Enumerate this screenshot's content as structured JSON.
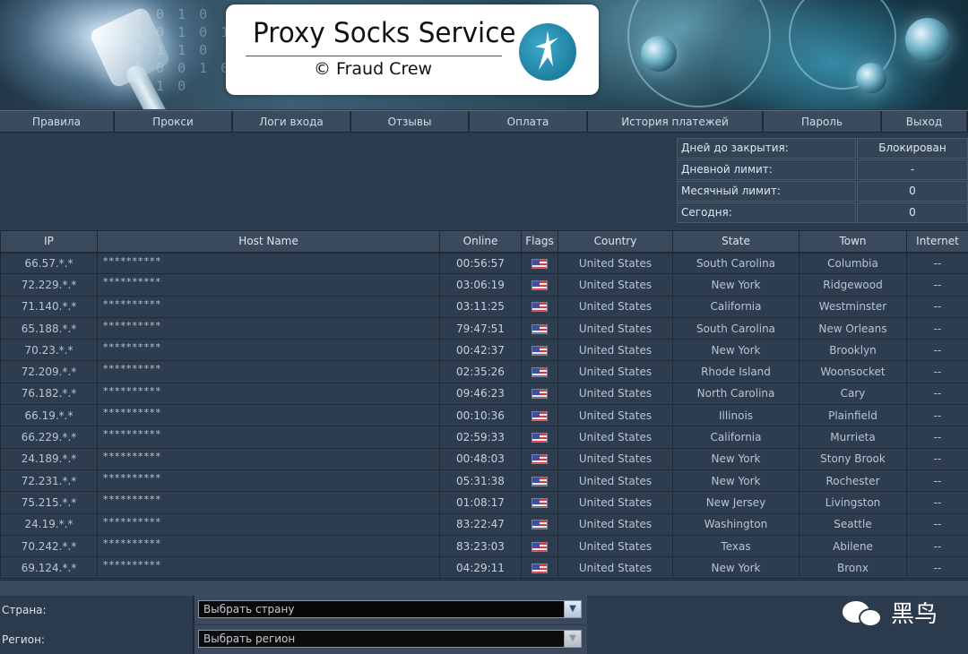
{
  "header": {
    "title": "Proxy Socks Service",
    "subtitle": "© Fraud Crew",
    "binary_text": "0 0 1 0\n1 0 1 0 1\n0 1 1 0\n1 0 0 1 0\n0 1 0"
  },
  "nav": [
    {
      "label": "Правила",
      "w": 128
    },
    {
      "label": "Прокси",
      "w": 132
    },
    {
      "label": "Логи входа",
      "w": 132
    },
    {
      "label": "Отзывы",
      "w": 132
    },
    {
      "label": "Оплата",
      "w": 132
    },
    {
      "label": "История платежей",
      "w": 196
    },
    {
      "label": "Пароль",
      "w": 132
    },
    {
      "label": "Выход",
      "w": 96
    }
  ],
  "stats": [
    {
      "label": "Дней до закрытия:",
      "value": "Блокирован"
    },
    {
      "label": "Дневной лимит:",
      "value": "-"
    },
    {
      "label": "Месячный лимит:",
      "value": "0"
    },
    {
      "label": "Сегодня:",
      "value": "0"
    }
  ],
  "table": {
    "columns": [
      "IP",
      "Host Name",
      "Online",
      "Flags",
      "Country",
      "State",
      "Town",
      "Internet"
    ],
    "rows": [
      {
        "ip": "66.57.*.*",
        "host": "**********",
        "online": "00:56:57",
        "country": "United States",
        "state": "South Carolina",
        "town": "Columbia",
        "internet": "--"
      },
      {
        "ip": "72.229.*.*",
        "host": "**********",
        "online": "03:06:19",
        "country": "United States",
        "state": "New York",
        "town": "Ridgewood",
        "internet": "--"
      },
      {
        "ip": "71.140.*.*",
        "host": "**********",
        "online": "03:11:25",
        "country": "United States",
        "state": "California",
        "town": "Westminster",
        "internet": "--"
      },
      {
        "ip": "65.188.*.*",
        "host": "**********",
        "online": "79:47:51",
        "country": "United States",
        "state": "South Carolina",
        "town": "New Orleans",
        "internet": "--"
      },
      {
        "ip": "70.23.*.*",
        "host": "**********",
        "online": "00:42:37",
        "country": "United States",
        "state": "New York",
        "town": "Brooklyn",
        "internet": "--"
      },
      {
        "ip": "72.209.*.*",
        "host": "**********",
        "online": "02:35:26",
        "country": "United States",
        "state": "Rhode Island",
        "town": "Woonsocket",
        "internet": "--"
      },
      {
        "ip": "76.182.*.*",
        "host": "**********",
        "online": "09:46:23",
        "country": "United States",
        "state": "North Carolina",
        "town": "Cary",
        "internet": "--"
      },
      {
        "ip": "66.19.*.*",
        "host": "**********",
        "online": "00:10:36",
        "country": "United States",
        "state": "Illinois",
        "town": "Plainfield",
        "internet": "--"
      },
      {
        "ip": "66.229.*.*",
        "host": "**********",
        "online": "02:59:33",
        "country": "United States",
        "state": "California",
        "town": "Murrieta",
        "internet": "--"
      },
      {
        "ip": "24.189.*.*",
        "host": "**********",
        "online": "00:48:03",
        "country": "United States",
        "state": "New York",
        "town": "Stony Brook",
        "internet": "--"
      },
      {
        "ip": "72.231.*.*",
        "host": "**********",
        "online": "05:31:38",
        "country": "United States",
        "state": "New York",
        "town": "Rochester",
        "internet": "--"
      },
      {
        "ip": "75.215.*.*",
        "host": "**********",
        "online": "01:08:17",
        "country": "United States",
        "state": "New Jersey",
        "town": "Livingston",
        "internet": "--"
      },
      {
        "ip": "24.19.*.*",
        "host": "**********",
        "online": "83:22:47",
        "country": "United States",
        "state": "Washington",
        "town": "Seattle",
        "internet": "--"
      },
      {
        "ip": "70.242.*.*",
        "host": "**********",
        "online": "83:23:03",
        "country": "United States",
        "state": "Texas",
        "town": "Abilene",
        "internet": "--"
      },
      {
        "ip": "69.124.*.*",
        "host": "**********",
        "online": "04:29:11",
        "country": "United States",
        "state": "New York",
        "town": "Bronx",
        "internet": "--"
      }
    ]
  },
  "filters": {
    "country_label": "Страна:",
    "country_value": "Выбрать страну",
    "region_label": "Регион:",
    "region_value": "Выбрать регион"
  },
  "watermark": {
    "text": "黑鸟"
  },
  "colors": {
    "background": "#2b3a4c",
    "header_cell": "#3a4a5c",
    "flag_red": "#cf3e45",
    "flag_blue": "#3b4fa8"
  }
}
